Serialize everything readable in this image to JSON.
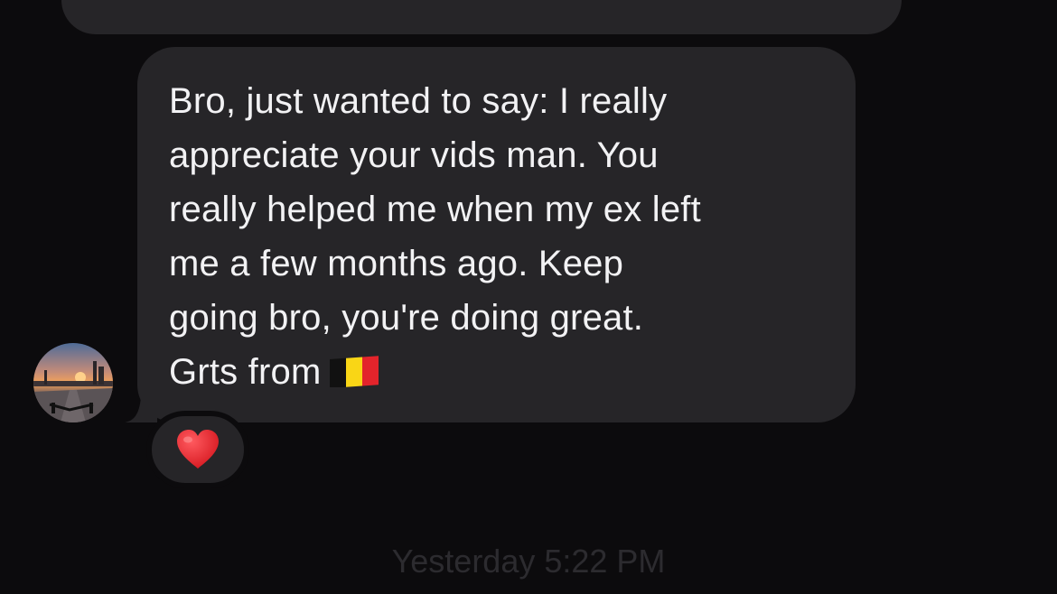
{
  "conversation": {
    "previous_message": {
      "text": ""
    },
    "message": {
      "lines": [
        "Bro, just wanted to say: I really",
        "appreciate your vids man. You",
        "really helped me when my ex left",
        "me a few months ago. Keep",
        "going bro, you're doing great.",
        "Grts from"
      ],
      "trailing_icon": "belgium-flag-icon",
      "reaction": "heart-icon",
      "reaction_color": "#e8232b"
    },
    "timestamp": "Yesterday 5:22 PM"
  },
  "colors": {
    "background": "#0c0b0d",
    "bubble": "#262528",
    "text": "#f2f2f4",
    "timestamp": "#2c2b2f"
  }
}
